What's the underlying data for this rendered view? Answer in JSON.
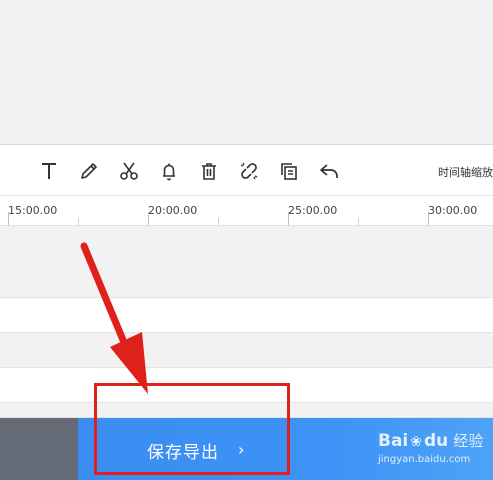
{
  "toolbar": {
    "tools": [
      {
        "icon": "text-icon",
        "label": "T"
      },
      {
        "icon": "pencil-icon"
      },
      {
        "icon": "scissors-icon"
      },
      {
        "icon": "bell-icon"
      },
      {
        "icon": "trash-icon"
      },
      {
        "icon": "unlink-icon"
      },
      {
        "icon": "copy-icon"
      },
      {
        "icon": "undo-icon"
      }
    ],
    "zoom_label": "时间轴缩放"
  },
  "ruler": {
    "ticks": [
      "15:00.00",
      "20:00.00",
      "25:00.00",
      "30:00.00"
    ]
  },
  "footer": {
    "save_export_label": "保存导出",
    "chevron": "›"
  },
  "watermark": {
    "brand_prefix": "Bai",
    "paw": "❀",
    "brand_suffix": "du",
    "jingyan": "经验",
    "url": "jingyan.baidu.com"
  },
  "colors": {
    "accent_blue": "#3d93f5",
    "annotation_red": "#e0201b",
    "dark_gray": "#646b77"
  }
}
